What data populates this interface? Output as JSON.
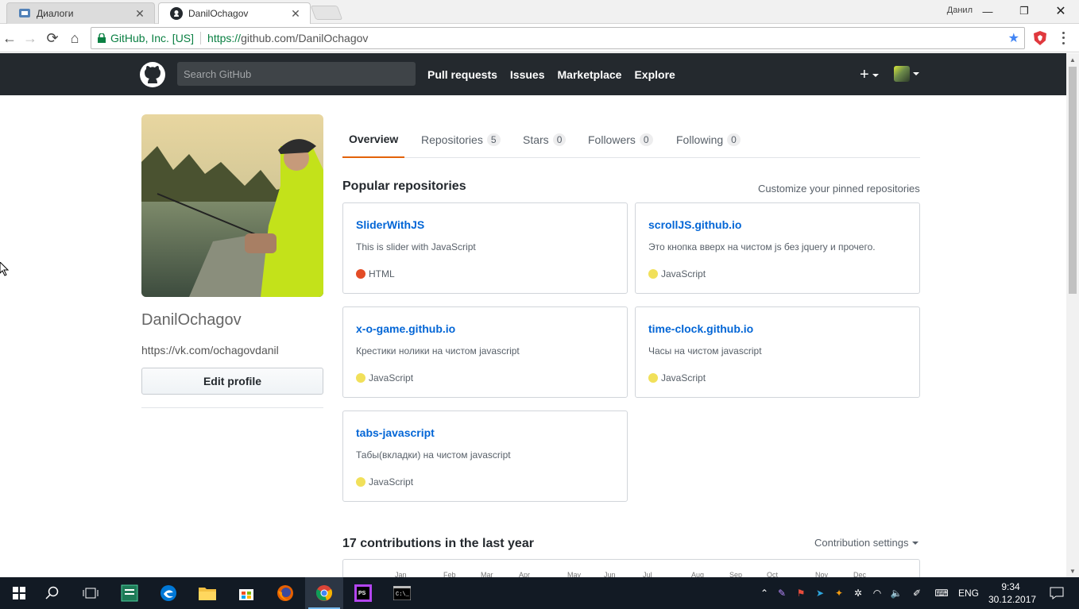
{
  "browser": {
    "tabs": [
      {
        "title": "Диалоги"
      },
      {
        "title": "DanilOchagov"
      }
    ],
    "window_user": "Данил",
    "secure_label": "GitHub, Inc. [US]",
    "url_protocol": "https://",
    "url_rest": "github.com/DanilOchagov"
  },
  "gh_header": {
    "search_placeholder": "Search GitHub",
    "nav": [
      "Pull requests",
      "Issues",
      "Marketplace",
      "Explore"
    ],
    "plus": "+"
  },
  "profile": {
    "username": "DanilOchagov",
    "website": "https://vk.com/ochagovdanil",
    "edit_button": "Edit profile"
  },
  "profile_tabs": [
    {
      "label": "Overview",
      "count": null
    },
    {
      "label": "Repositories",
      "count": "5"
    },
    {
      "label": "Stars",
      "count": "0"
    },
    {
      "label": "Followers",
      "count": "0"
    },
    {
      "label": "Following",
      "count": "0"
    }
  ],
  "pinned": {
    "title": "Popular repositories",
    "customize": "Customize your pinned repositories",
    "repos": [
      {
        "name": "SliderWithJS",
        "description": "This is slider with JavaScript",
        "language": "HTML",
        "color": "#e34c26"
      },
      {
        "name": "scrollJS.github.io",
        "description": "Это кнопка вверх на чистом js без jquery и прочего.",
        "language": "JavaScript",
        "color": "#f1e05a"
      },
      {
        "name": "x-o-game.github.io",
        "description": "Крестики нолики на чистом javascript",
        "language": "JavaScript",
        "color": "#f1e05a"
      },
      {
        "name": "time-clock.github.io",
        "description": "Часы на чистом javascript",
        "language": "JavaScript",
        "color": "#f1e05a"
      },
      {
        "name": "tabs-javascript",
        "description": "Табы(вкладки) на чистом javascript",
        "language": "JavaScript",
        "color": "#f1e05a"
      }
    ]
  },
  "contributions": {
    "title": "17 contributions in the last year",
    "settings": "Contribution settings",
    "months": [
      "Jan",
      "Feb",
      "Mar",
      "Apr",
      "May",
      "Jun",
      "Jul",
      "Aug",
      "Sep",
      "Oct",
      "Nov",
      "Dec"
    ]
  },
  "taskbar": {
    "language": "ENG",
    "time": "9:34",
    "date": "30.12.2017"
  }
}
